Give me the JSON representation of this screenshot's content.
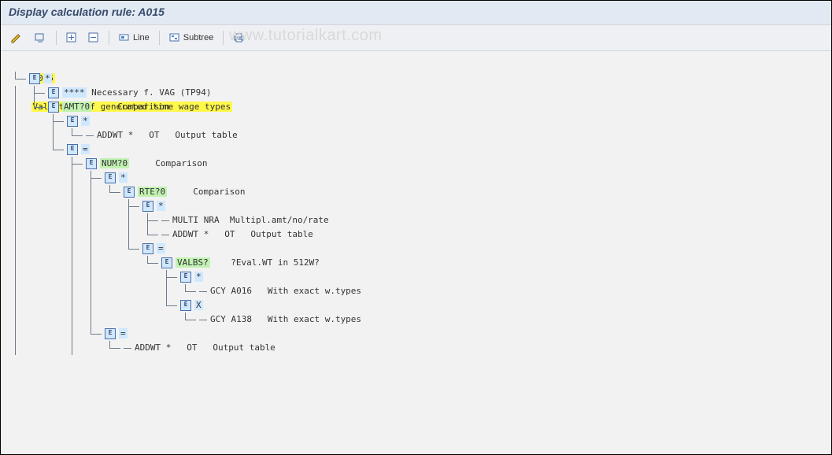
{
  "title": "Display calculation rule: A015",
  "watermark": "www.tutorialkart.com",
  "toolbar": {
    "line_label": "Line",
    "subtree_label": "Subtree"
  },
  "tree": {
    "root_code": "A015",
    "root_desc": "Valuation of generated time wage types",
    "rows": [
      {
        "indent": 1,
        "conn": [
          "tee"
        ],
        "handle": true,
        "token": "*",
        "cls": "hl-blue",
        "desc": ""
      },
      {
        "indent": 2,
        "conn": [
          "vline",
          "el"
        ],
        "handle": true,
        "token": "****",
        "cls": "hl-blue",
        "desc": "Necessary f. VAG (TP94)",
        "gap1": 1
      },
      {
        "indent": 2,
        "conn": [
          "vline",
          "tee"
        ],
        "handle": true,
        "token": "AMT?0",
        "cls": "hl-green",
        "desc": "Comparison",
        "gap1": 5
      },
      {
        "indent": 3,
        "conn": [
          "vline",
          "blank",
          "el"
        ],
        "handle": true,
        "token": "*",
        "cls": "hl-blue",
        "desc": ""
      },
      {
        "indent": 4,
        "conn": [
          "vline",
          "blank",
          "vline",
          "tee"
        ],
        "leaf": true,
        "code": "ADDWT *   OT   Output table"
      },
      {
        "indent": 3,
        "conn": [
          "vline",
          "blank",
          "tee"
        ],
        "handle": true,
        "token": "=",
        "cls": "hl-blue",
        "desc": ""
      },
      {
        "indent": 4,
        "conn": [
          "vline",
          "blank",
          "blank",
          "el"
        ],
        "handle": true,
        "token": "NUM?0",
        "cls": "hl-green",
        "desc": "Comparison",
        "gap1": 5
      },
      {
        "indent": 5,
        "conn": [
          "vline",
          "blank",
          "blank",
          "vline",
          "el"
        ],
        "handle": true,
        "token": "*",
        "cls": "hl-blue",
        "desc": ""
      },
      {
        "indent": 6,
        "conn": [
          "vline",
          "blank",
          "blank",
          "vline",
          "vline",
          "tee"
        ],
        "handle": true,
        "token": "RTE?0",
        "cls": "hl-green",
        "desc": "Comparison",
        "gap1": 5
      },
      {
        "indent": 7,
        "conn": [
          "vline",
          "blank",
          "blank",
          "vline",
          "vline",
          "blank",
          "el"
        ],
        "handle": true,
        "token": "*",
        "cls": "hl-blue",
        "desc": ""
      },
      {
        "indent": 8,
        "conn": [
          "vline",
          "blank",
          "blank",
          "vline",
          "vline",
          "blank",
          "vline",
          "el"
        ],
        "leaf": true,
        "code": "MULTI NRA  Multipl.amt/no/rate"
      },
      {
        "indent": 8,
        "conn": [
          "vline",
          "blank",
          "blank",
          "vline",
          "vline",
          "blank",
          "vline",
          "tee"
        ],
        "leaf": true,
        "code": "ADDWT *   OT   Output table"
      },
      {
        "indent": 7,
        "conn": [
          "vline",
          "blank",
          "blank",
          "vline",
          "vline",
          "blank",
          "tee"
        ],
        "handle": true,
        "token": "=",
        "cls": "hl-blue",
        "desc": ""
      },
      {
        "indent": 8,
        "conn": [
          "vline",
          "blank",
          "blank",
          "vline",
          "vline",
          "blank",
          "blank",
          "tee"
        ],
        "handle": true,
        "token": "VALBS?",
        "cls": "hl-green",
        "desc": "?Eval.WT in 512W?",
        "gap1": 4
      },
      {
        "indent": 9,
        "conn": [
          "vline",
          "blank",
          "blank",
          "vline",
          "vline",
          "blank",
          "blank",
          "blank",
          "el"
        ],
        "handle": true,
        "token": "*",
        "cls": "hl-blue",
        "desc": ""
      },
      {
        "indent": 10,
        "conn": [
          "vline",
          "blank",
          "blank",
          "vline",
          "vline",
          "blank",
          "blank",
          "blank",
          "vline",
          "tee"
        ],
        "leaf": true,
        "code": "GCY A016   With exact w.types"
      },
      {
        "indent": 9,
        "conn": [
          "vline",
          "blank",
          "blank",
          "vline",
          "vline",
          "blank",
          "blank",
          "blank",
          "tee"
        ],
        "handle": true,
        "token": "X",
        "cls": "hl-blue",
        "desc": ""
      },
      {
        "indent": 10,
        "conn": [
          "vline",
          "blank",
          "blank",
          "vline",
          "vline",
          "blank",
          "blank",
          "blank",
          "blank",
          "tee"
        ],
        "leaf": true,
        "code": "GCY A138   With exact w.types"
      },
      {
        "indent": 5,
        "conn": [
          "vline",
          "blank",
          "blank",
          "vline",
          "tee"
        ],
        "handle": true,
        "token": "=",
        "cls": "hl-blue",
        "desc": ""
      },
      {
        "indent": 6,
        "conn": [
          "vline",
          "blank",
          "blank",
          "vline",
          "blank",
          "tee"
        ],
        "leaf": true,
        "code": "ADDWT *   OT   Output table"
      }
    ]
  }
}
